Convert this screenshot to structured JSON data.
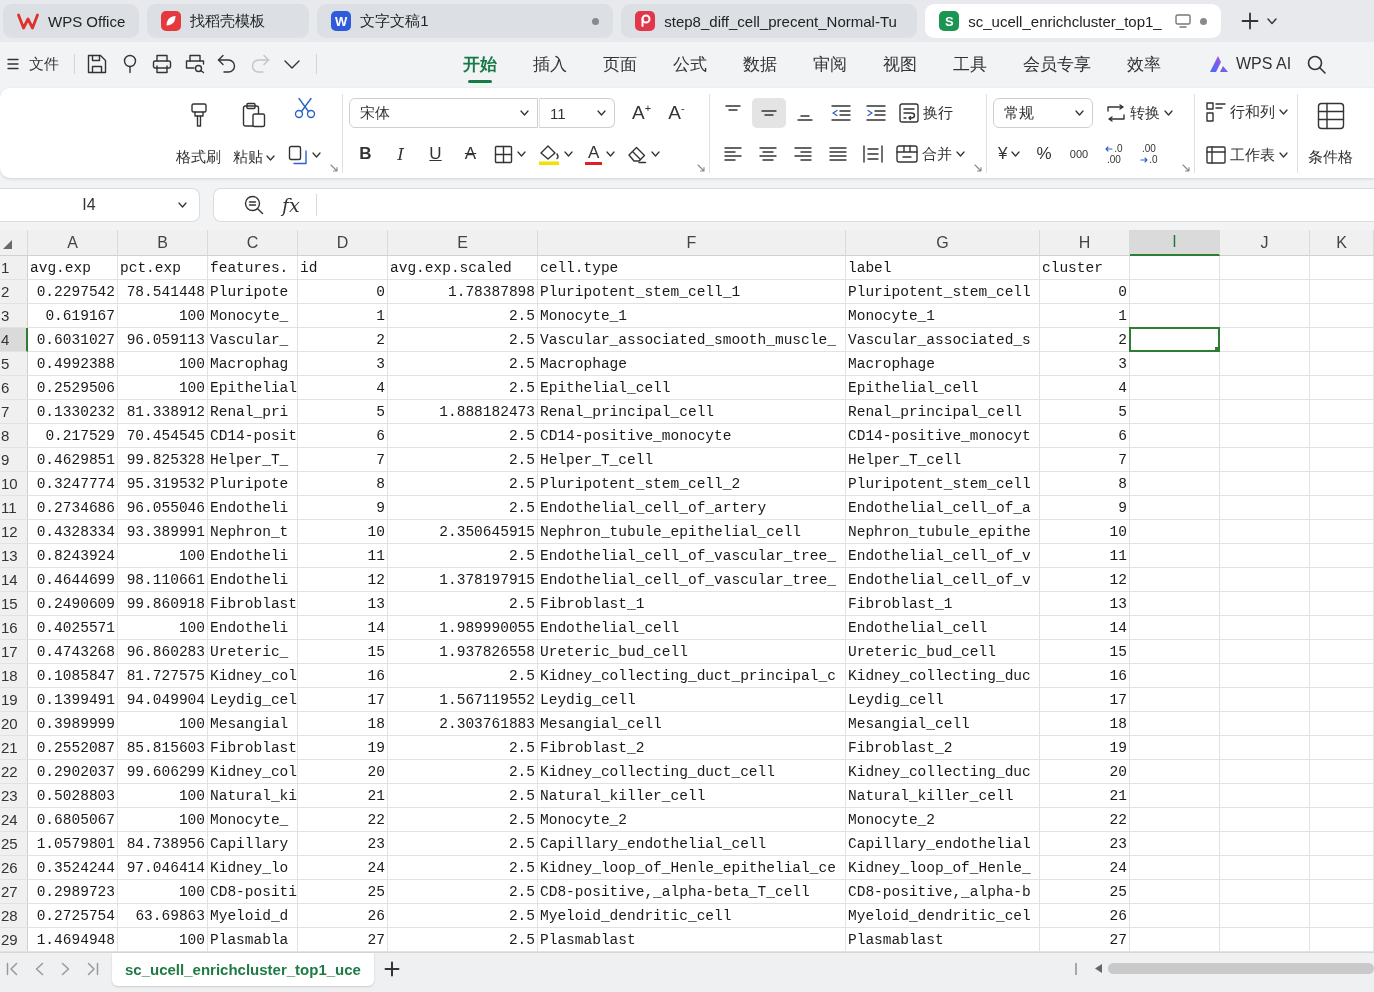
{
  "app_tabs": [
    {
      "kind": "wps",
      "label": "WPS Office",
      "selected": false,
      "modified": false
    },
    {
      "kind": "template",
      "label": "找稻壳模板",
      "selected": false,
      "modified": false
    },
    {
      "kind": "writer",
      "icon_letter": "W",
      "label": "文字文稿1",
      "selected": false,
      "modified": true
    },
    {
      "kind": "pdf",
      "label": "step8_diff_cell_precent_Normal-Tu",
      "selected": false,
      "modified": false
    },
    {
      "kind": "sheet",
      "icon_letter": "S",
      "label": "sc_ucell_enrichcluster_top1_",
      "selected": true,
      "modified": true
    }
  ],
  "menu": {
    "file_label": "文件",
    "quick_access": [
      {
        "kind": "save",
        "disabled": false
      },
      {
        "kind": "export",
        "disabled": false
      },
      {
        "kind": "print",
        "disabled": false
      },
      {
        "kind": "preview",
        "disabled": false
      },
      {
        "kind": "undo",
        "disabled": false
      },
      {
        "kind": "redo",
        "disabled": true
      },
      {
        "kind": "more",
        "disabled": false
      }
    ],
    "tabs": [
      {
        "label": "开始",
        "selected": true
      },
      {
        "label": "插入",
        "selected": false
      },
      {
        "label": "页面",
        "selected": false
      },
      {
        "label": "公式",
        "selected": false
      },
      {
        "label": "数据",
        "selected": false
      },
      {
        "label": "审阅",
        "selected": false
      },
      {
        "label": "视图",
        "selected": false
      },
      {
        "label": "工具",
        "selected": false
      },
      {
        "label": "会员专享",
        "selected": false
      },
      {
        "label": "效率",
        "selected": false
      }
    ],
    "ai_label": "WPS AI"
  },
  "ribbon": {
    "format_painter": "格式刷",
    "paste": "粘贴",
    "font_name": "宋体",
    "font_size": "11",
    "grow_font": "A$^{+}$",
    "shrink_font": "A$^{-}$",
    "text_styles": [
      {
        "kind": "bold",
        "label": "B"
      },
      {
        "kind": "italic",
        "label": "I"
      },
      {
        "kind": "underline",
        "label": "U"
      },
      {
        "kind": "strikethrough",
        "label": "A"
      }
    ],
    "font_color": "A",
    "vertical_align": [
      {
        "selected": false
      },
      {
        "selected": true
      },
      {
        "selected": false
      }
    ],
    "wrap_text": "换行",
    "merge": "合并",
    "number_format": "常规",
    "convert": "转换",
    "currency": "¥",
    "percent": "%",
    "thousands": "000",
    "decimals": [
      {
        "kind": "increase",
        "top": ".0",
        "bottom": ".00"
      },
      {
        "kind": "decrease",
        "top": ".00",
        "bottom": ".0"
      }
    ],
    "rows_columns": "行和列",
    "worksheet": "工作表",
    "conditional_format": "条件格"
  },
  "formula_bar": {
    "cell_ref": "I4",
    "function_label": "fx"
  },
  "sheet": {
    "columns": [
      {
        "label": "A",
        "kind": "number",
        "selected": false
      },
      {
        "label": "B",
        "kind": "number",
        "selected": false
      },
      {
        "label": "C",
        "kind": "text",
        "selected": false
      },
      {
        "label": "D",
        "kind": "number",
        "selected": false
      },
      {
        "label": "E",
        "kind": "number",
        "selected": false
      },
      {
        "label": "F",
        "kind": "text",
        "selected": false
      },
      {
        "label": "G",
        "kind": "text",
        "selected": false
      },
      {
        "label": "H",
        "kind": "number",
        "selected": false
      },
      {
        "label": "I",
        "kind": "text",
        "selected": true
      },
      {
        "label": "J",
        "kind": "text",
        "selected": false
      },
      {
        "label": "K",
        "kind": "text",
        "selected": false
      }
    ],
    "rows": [
      {
        "number": "1",
        "kind": "header",
        "selected": false,
        "cells": [
          "avg.exp",
          "pct.exp",
          "features.",
          "id",
          "avg.exp.scaled",
          "cell.type",
          "label",
          "cluster"
        ]
      },
      {
        "number": "2",
        "kind": "data",
        "selected": false,
        "cells": [
          "0.2297542",
          "78.541448",
          "Pluripote",
          "0",
          "1.78387898",
          "Pluripotent_stem_cell_1",
          "Pluripotent_stem_cell",
          "0"
        ]
      },
      {
        "number": "3",
        "kind": "data",
        "selected": false,
        "cells": [
          "0.619167",
          "100",
          "Monocyte_",
          "1",
          "2.5",
          "Monocyte_1",
          "Monocyte_1",
          "1"
        ]
      },
      {
        "number": "4",
        "kind": "data",
        "selected": true,
        "cells": [
          "0.6031027",
          "96.059113",
          "Vascular_",
          "2",
          "2.5",
          "Vascular_associated_smooth_muscle_",
          "Vascular_associated_s",
          "2"
        ]
      },
      {
        "number": "5",
        "kind": "data",
        "selected": false,
        "cells": [
          "0.4992388",
          "100",
          "Macrophag",
          "3",
          "2.5",
          "Macrophage",
          "Macrophage",
          "3"
        ]
      },
      {
        "number": "6",
        "kind": "data",
        "selected": false,
        "cells": [
          "0.2529506",
          "100",
          "Epithelial",
          "4",
          "2.5",
          "Epithelial_cell",
          "Epithelial_cell",
          "4"
        ]
      },
      {
        "number": "7",
        "kind": "data",
        "selected": false,
        "cells": [
          "0.1330232",
          "81.338912",
          "Renal_pri",
          "5",
          "1.888182473",
          "Renal_principal_cell",
          "Renal_principal_cell",
          "5"
        ]
      },
      {
        "number": "8",
        "kind": "data",
        "selected": false,
        "cells": [
          "0.217529",
          "70.454545",
          "CD14-posit",
          "6",
          "2.5",
          "CD14-positive_monocyte",
          "CD14-positive_monocyt",
          "6"
        ]
      },
      {
        "number": "9",
        "kind": "data",
        "selected": false,
        "cells": [
          "0.4629851",
          "99.825328",
          "Helper_T_",
          "7",
          "2.5",
          "Helper_T_cell",
          "Helper_T_cell",
          "7"
        ]
      },
      {
        "number": "10",
        "kind": "data",
        "selected": false,
        "cells": [
          "0.3247774",
          "95.319532",
          "Pluripote",
          "8",
          "2.5",
          "Pluripotent_stem_cell_2",
          "Pluripotent_stem_cell",
          "8"
        ]
      },
      {
        "number": "11",
        "kind": "data",
        "selected": false,
        "cells": [
          "0.2734686",
          "96.055046",
          "Endotheli",
          "9",
          "2.5",
          "Endothelial_cell_of_artery",
          "Endothelial_cell_of_a",
          "9"
        ]
      },
      {
        "number": "12",
        "kind": "data",
        "selected": false,
        "cells": [
          "0.4328334",
          "93.389991",
          "Nephron_t",
          "10",
          "2.350645915",
          "Nephron_tubule_epithelial_cell",
          "Nephron_tubule_epithe",
          "10"
        ]
      },
      {
        "number": "13",
        "kind": "data",
        "selected": false,
        "cells": [
          "0.8243924",
          "100",
          "Endotheli",
          "11",
          "2.5",
          "Endothelial_cell_of_vascular_tree_",
          "Endothelial_cell_of_v",
          "11"
        ]
      },
      {
        "number": "14",
        "kind": "data",
        "selected": false,
        "cells": [
          "0.4644699",
          "98.110661",
          "Endotheli",
          "12",
          "1.378197915",
          "Endothelial_cell_of_vascular_tree_",
          "Endothelial_cell_of_v",
          "12"
        ]
      },
      {
        "number": "15",
        "kind": "data",
        "selected": false,
        "cells": [
          "0.2490609",
          "99.860918",
          "Fibroblast",
          "13",
          "2.5",
          "Fibroblast_1",
          "Fibroblast_1",
          "13"
        ]
      },
      {
        "number": "16",
        "kind": "data",
        "selected": false,
        "cells": [
          "0.4025571",
          "100",
          "Endotheli",
          "14",
          "1.989990055",
          "Endothelial_cell",
          "Endothelial_cell",
          "14"
        ]
      },
      {
        "number": "17",
        "kind": "data",
        "selected": false,
        "cells": [
          "0.4743268",
          "96.860283",
          "Ureteric_",
          "15",
          "1.937826558",
          "Ureteric_bud_cell",
          "Ureteric_bud_cell",
          "15"
        ]
      },
      {
        "number": "18",
        "kind": "data",
        "selected": false,
        "cells": [
          "0.1085847",
          "81.727575",
          "Kidney_col",
          "16",
          "2.5",
          "Kidney_collecting_duct_principal_c",
          "Kidney_collecting_duc",
          "16"
        ]
      },
      {
        "number": "19",
        "kind": "data",
        "selected": false,
        "cells": [
          "0.1399491",
          "94.049904",
          "Leydig_cel",
          "17",
          "1.567119552",
          "Leydig_cell",
          "Leydig_cell",
          "17"
        ]
      },
      {
        "number": "20",
        "kind": "data",
        "selected": false,
        "cells": [
          "0.3989999",
          "100",
          "Mesangial",
          "18",
          "2.303761883",
          "Mesangial_cell",
          "Mesangial_cell",
          "18"
        ]
      },
      {
        "number": "21",
        "kind": "data",
        "selected": false,
        "cells": [
          "0.2552087",
          "85.815603",
          "Fibroblast",
          "19",
          "2.5",
          "Fibroblast_2",
          "Fibroblast_2",
          "19"
        ]
      },
      {
        "number": "22",
        "kind": "data",
        "selected": false,
        "cells": [
          "0.2902037",
          "99.606299",
          "Kidney_col",
          "20",
          "2.5",
          "Kidney_collecting_duct_cell",
          "Kidney_collecting_duc",
          "20"
        ]
      },
      {
        "number": "23",
        "kind": "data",
        "selected": false,
        "cells": [
          "0.5028803",
          "100",
          "Natural_ki",
          "21",
          "2.5",
          "Natural_killer_cell",
          "Natural_killer_cell",
          "21"
        ]
      },
      {
        "number": "24",
        "kind": "data",
        "selected": false,
        "cells": [
          "0.6805067",
          "100",
          "Monocyte_",
          "22",
          "2.5",
          "Monocyte_2",
          "Monocyte_2",
          "22"
        ]
      },
      {
        "number": "25",
        "kind": "data",
        "selected": false,
        "cells": [
          "1.0579801",
          "84.738956",
          "Capillary",
          "23",
          "2.5",
          "Capillary_endothelial_cell",
          "Capillary_endothelial",
          "23"
        ]
      },
      {
        "number": "26",
        "kind": "data",
        "selected": false,
        "cells": [
          "0.3524244",
          "97.046414",
          "Kidney_lo",
          "24",
          "2.5",
          "Kidney_loop_of_Henle_epithelial_ce",
          "Kidney_loop_of_Henle_",
          "24"
        ]
      },
      {
        "number": "27",
        "kind": "data",
        "selected": false,
        "cells": [
          "0.2989723",
          "100",
          "CD8-positi",
          "25",
          "2.5",
          "CD8-positive,_alpha-beta_T_cell",
          "CD8-positive,_alpha-b",
          "25"
        ]
      },
      {
        "number": "28",
        "kind": "data",
        "selected": false,
        "cells": [
          "0.2725754",
          "63.69863",
          "Myeloid_d",
          "26",
          "2.5",
          "Myeloid_dendritic_cell",
          "Myeloid_dendritic_cel",
          "26"
        ]
      },
      {
        "number": "29",
        "kind": "data",
        "selected": false,
        "cells": [
          "1.4694948",
          "100",
          "Plasmabla",
          "27",
          "2.5",
          "Plasmablast",
          "Plasmablast",
          "27"
        ]
      }
    ]
  },
  "sheet_tabs": [
    {
      "label": "sc_ucell_enrichcluster_top1_uce",
      "selected": true
    }
  ]
}
